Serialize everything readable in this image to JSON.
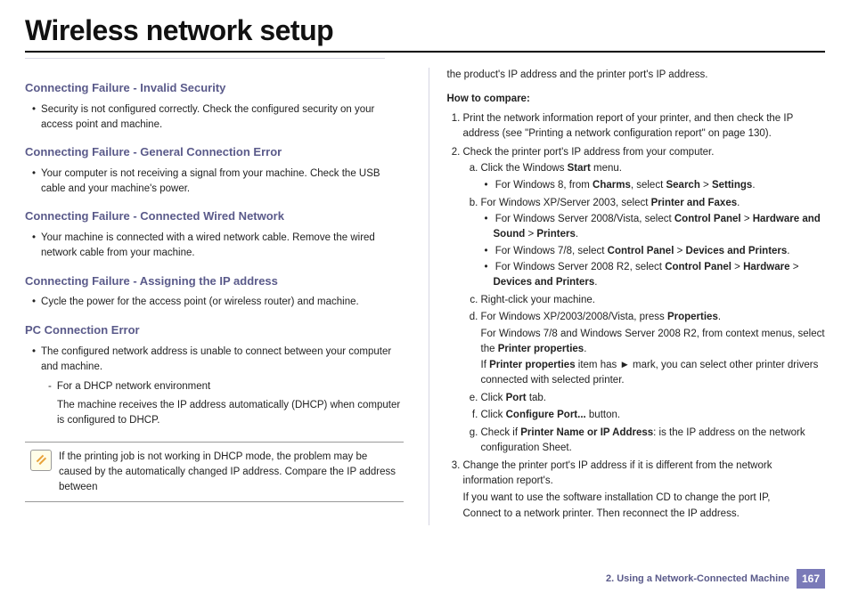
{
  "title": "Wireless network setup",
  "left": {
    "s1": {
      "h": "Connecting Failure - Invalid Security",
      "b": "Security is not configured correctly. Check the configured security on your access point and machine."
    },
    "s2": {
      "h": "Connecting Failure - General Connection Error",
      "b": "Your computer is not receiving a signal from your machine. Check the USB cable and your machine's power."
    },
    "s3": {
      "h": "Connecting Failure - Connected Wired Network",
      "b": "Your machine is connected with a wired network cable. Remove the wired network cable from your machine."
    },
    "s4": {
      "h": "Connecting Failure - Assigning the IP address",
      "b": "Cycle the power for the access point (or wireless router) and machine."
    },
    "s5": {
      "h": "PC Connection Error",
      "b": "The configured network address is unable to connect between your computer and machine.",
      "d1": "For a DHCP network environment",
      "d1b": "The machine receives the IP address automatically (DHCP) when computer is configured to DHCP."
    },
    "note": "If the printing job is not working in DHCP mode, the problem may be caused by the automatically changed IP address. Compare the IP address between"
  },
  "right": {
    "top": "the product's IP address and the printer port's IP address.",
    "howto": "How to compare:",
    "step1": "Print the network information report of your printer, and then check the IP address (see \"Printing a network configuration report\" on page 130).",
    "step2": "Check the printer port's IP address from your computer.",
    "a_pre": "Click the Windows ",
    "a_bold": "Start",
    "a_post": " menu.",
    "a_sub_pre": "For Windows 8, from ",
    "a_sub_b1": "Charms",
    "a_sub_mid": ", select ",
    "a_sub_b2": "Search",
    "a_sub_gt": " > ",
    "a_sub_b3": "Settings",
    "a_sub_end": ".",
    "b_pre": "For Windows XP/Server 2003, select ",
    "b_bold": "Printer and Faxes",
    "b_end": ".",
    "b_s1_pre": "For Windows Server 2008/Vista, select ",
    "b_s1_b1": "Control Panel",
    "b_s1_gt1": " > ",
    "b_s1_b2": "Hardware and Sound",
    "b_s1_gt2": " > ",
    "b_s1_b3": "Printers",
    "b_s1_end": ".",
    "b_s2_pre": "For Windows 7/8, select ",
    "b_s2_b1": "Control Panel",
    "b_s2_gt": " > ",
    "b_s2_b2": "Devices and Printers",
    "b_s2_end": ".",
    "b_s3_pre": "For Windows Server 2008 R2, select ",
    "b_s3_b1": "Control Panel",
    "b_s3_gt1": " > ",
    "b_s3_b2": "Hardware",
    "b_s3_gt2": " > ",
    "b_s3_b3": "Devices and Printers",
    "b_s3_end": ".",
    "c": "Right-click your machine.",
    "d_pre": "For Windows XP/2003/2008/Vista, press ",
    "d_bold": "Properties",
    "d_end": ".",
    "d_l2a": "For Windows 7/8 and Windows Server 2008 R2, from context menus, select the ",
    "d_l2b": "Printer properties",
    "d_l2c": ".",
    "d_l3a": "If ",
    "d_l3b": "Printer properties",
    "d_l3c": " item has ► mark, you can select other printer drivers connected with selected printer.",
    "e_pre": "Click ",
    "e_bold": "Port",
    "e_post": " tab.",
    "f_pre": "Click ",
    "f_bold": "Configure Port...",
    "f_post": " button.",
    "g_pre": "Check if ",
    "g_bold": "Printer Name or IP Address",
    "g_post": ": is the IP address on the network configuration Sheet.",
    "step3": "Change the printer port's IP address if it is different from the network information report's.",
    "step3b": "If you  want to use the software installation CD to change the port IP,",
    "step3c": "Connect to a network printer. Then reconnect the IP address."
  },
  "footer": {
    "chapter": "2.  Using a Network-Connected Machine",
    "page": "167"
  }
}
